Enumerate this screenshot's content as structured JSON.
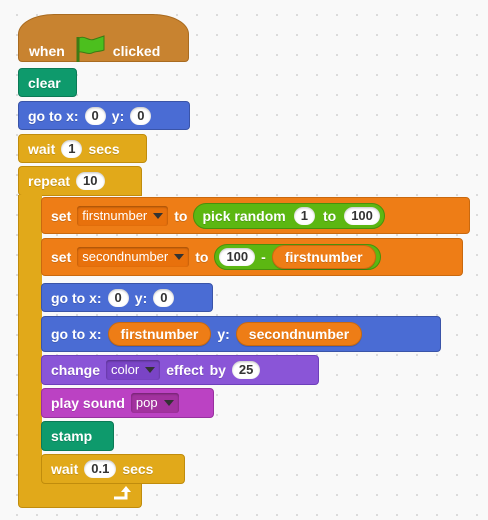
{
  "hat": {
    "when": "when",
    "clicked": "clicked",
    "icon": "green-flag-icon"
  },
  "clear": {
    "label": "clear"
  },
  "goto1": {
    "label": "go to x:",
    "x": "0",
    "ylabel": "y:",
    "y": "0"
  },
  "wait1": {
    "label": "wait",
    "value": "1",
    "unit": "secs"
  },
  "repeat": {
    "label": "repeat",
    "value": "10"
  },
  "set1": {
    "label": "set",
    "variable": "firstnumber",
    "to": "to",
    "op_label": "pick random",
    "from": "1",
    "op_to": "to",
    "max": "100"
  },
  "set2": {
    "label": "set",
    "variable": "secondnumber",
    "to": "to",
    "left": "100",
    "minus": "-",
    "right": "firstnumber"
  },
  "goto2": {
    "label": "go to x:",
    "x": "0",
    "ylabel": "y:",
    "y": "0"
  },
  "goto3": {
    "label": "go to x:",
    "x": "firstnumber",
    "ylabel": "y:",
    "y": "secondnumber"
  },
  "change": {
    "label": "change",
    "effect": "color",
    "effect_label": "effect",
    "by": "by",
    "value": "25"
  },
  "play": {
    "label": "play sound",
    "sound": "pop"
  },
  "stamp": {
    "label": "stamp"
  },
  "wait2": {
    "label": "wait",
    "value": "0.1",
    "unit": "secs"
  },
  "loop_icon": "loop-arrow-icon",
  "colors": {
    "events": "#c88330",
    "pen": "#0e9a6c",
    "motion": "#4a6cd4",
    "control": "#e1a91a",
    "data": "#ee7d16",
    "looks": "#8a55d7",
    "sound": "#bb42c3",
    "operators": "#5cb712"
  }
}
